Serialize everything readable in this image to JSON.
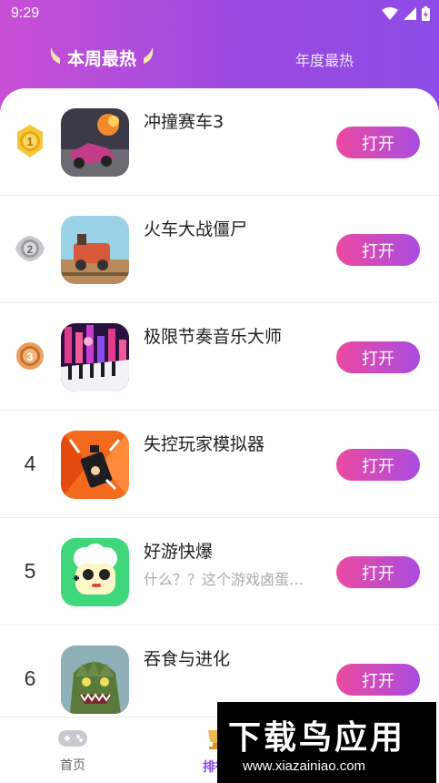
{
  "status_bar": {
    "time": "9:29"
  },
  "tabs": {
    "weekly": "本周最热",
    "yearly": "年度最热"
  },
  "apps": [
    {
      "rank": "1",
      "name": "冲撞赛车3",
      "desc": "",
      "button": "打开"
    },
    {
      "rank": "2",
      "name": "火车大战僵尸",
      "desc": "",
      "button": "打开"
    },
    {
      "rank": "3",
      "name": "极限节奏音乐大师",
      "desc": "",
      "button": "打开"
    },
    {
      "rank": "4",
      "name": "失控玩家模拟器",
      "desc": "",
      "button": "打开"
    },
    {
      "rank": "5",
      "name": "好游快爆",
      "desc": "什么？？这个游戏卤蛋…",
      "button": "打开"
    },
    {
      "rank": "6",
      "name": "吞食与进化",
      "desc": "",
      "button": "打开"
    }
  ],
  "bottom_nav": {
    "home": "首页",
    "rank": "排行"
  },
  "watermark": {
    "title": "下载鸟应用",
    "url": "www.xiazainiao.com"
  },
  "colors": {
    "header_start": "#c94fd6",
    "header_end": "#8d4ce6",
    "button_start": "#ec4aa0",
    "button_end": "#a94ce0"
  },
  "icons": [
    "wifi-icon",
    "signal-icon",
    "battery-icon",
    "laurel-icon",
    "gold-medal-icon",
    "silver-medal-icon",
    "bronze-medal-icon",
    "gamepad-icon",
    "trophy-icon"
  ]
}
